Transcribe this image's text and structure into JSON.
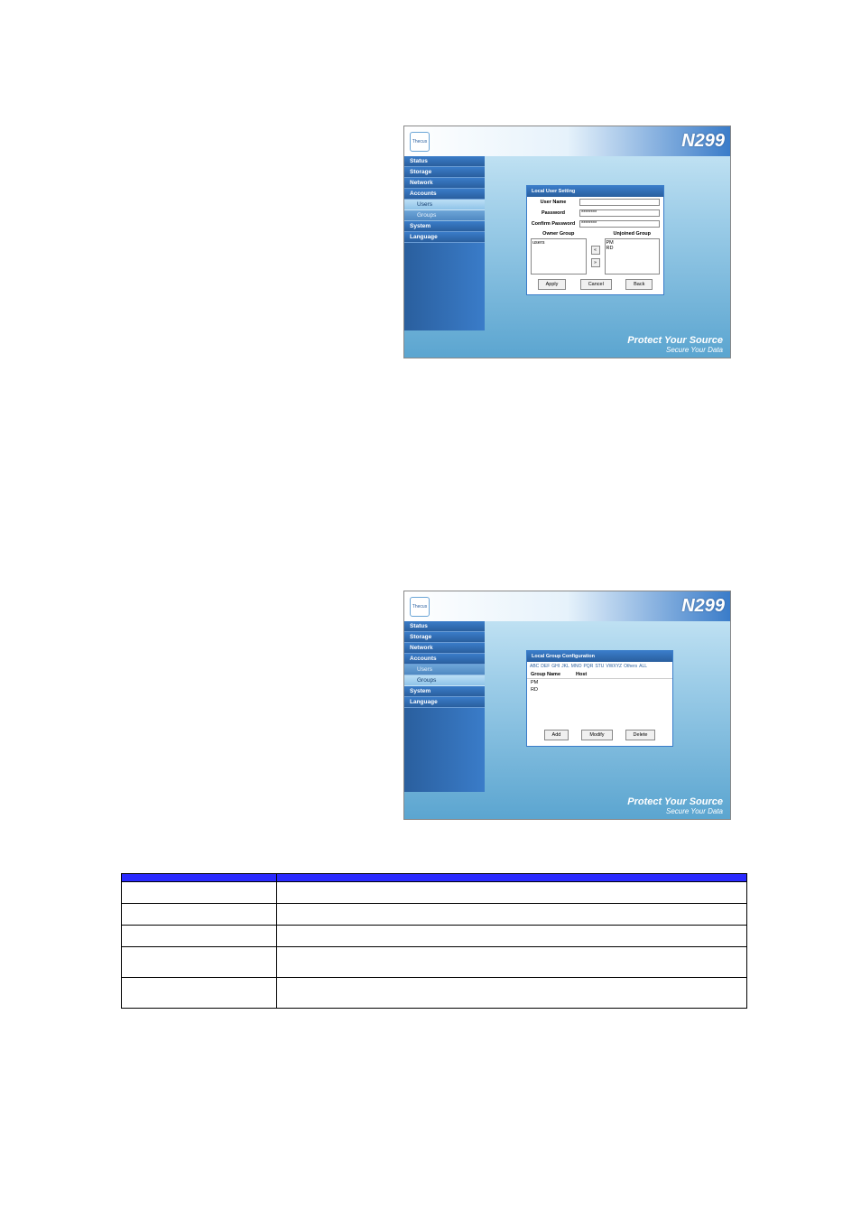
{
  "model": "N299",
  "logo_text": "Thecus",
  "tagline": {
    "line1": "Protect Your Source",
    "line2": "Secure Your Data"
  },
  "sidebar": {
    "items": [
      {
        "label": "Status"
      },
      {
        "label": "Storage"
      },
      {
        "label": "Network"
      },
      {
        "label": "Accounts"
      },
      {
        "label": "Users",
        "sub": true,
        "active1": true
      },
      {
        "label": "Groups",
        "sub": true,
        "active2": true
      },
      {
        "label": "System"
      },
      {
        "label": "Language"
      }
    ]
  },
  "panel1": {
    "title": "Local User Setting",
    "rows": {
      "user_name_label": "User Name",
      "user_name_value": "",
      "password_label": "Password",
      "password_value": "********",
      "confirm_label": "Confirm Password",
      "confirm_value": "********"
    },
    "owner_header": "Owner Group",
    "unjoined_header": "Unjoined Group",
    "owner_items": [
      "users"
    ],
    "unjoined_items": [
      "PM",
      "RD"
    ],
    "buttons": {
      "apply": "Apply",
      "cancel": "Cancel",
      "back": "Back"
    }
  },
  "panel2": {
    "title": "Local Group Configuration",
    "alpha": [
      "ABC",
      "DEF",
      "GHI",
      "JKL",
      "MNO",
      "PQR",
      "STU",
      "VWXYZ",
      "Others",
      "ALL"
    ],
    "cols": {
      "c1": "Group Name",
      "c2": "Host"
    },
    "rows": [
      {
        "name": "PM",
        "host": ""
      },
      {
        "name": "RD",
        "host": ""
      }
    ],
    "buttons": {
      "add": "Add",
      "modify": "Modify",
      "delete": "Delete"
    }
  },
  "desc_table": {
    "headers": {
      "h1": "",
      "h2": ""
    },
    "rows": [
      {
        "c1": "",
        "c2": ""
      },
      {
        "c1": "",
        "c2": ""
      },
      {
        "c1": "",
        "c2": ""
      },
      {
        "c1": "",
        "c2": ""
      },
      {
        "c1": "",
        "c2": ""
      }
    ]
  }
}
